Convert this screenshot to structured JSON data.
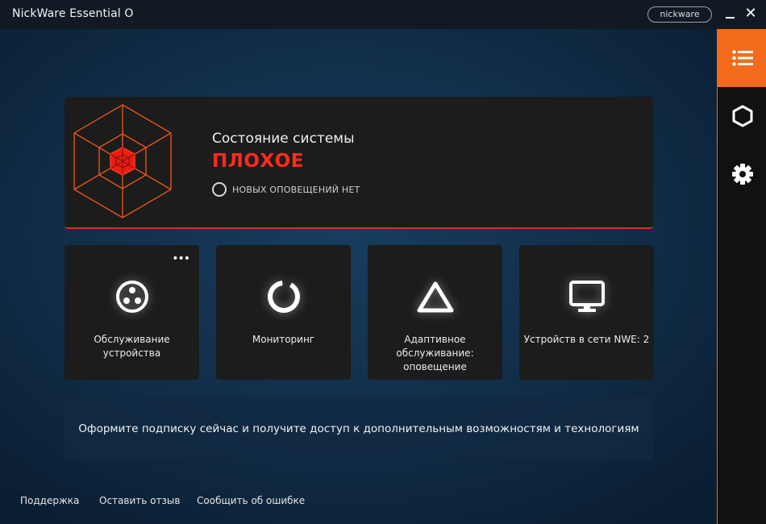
{
  "window": {
    "title": "NickWare Essential O",
    "user": "nickware",
    "minimize_icon": "minimize-icon",
    "close_icon": "close-icon"
  },
  "sidebar": {
    "items": [
      {
        "icon": "list-icon",
        "active": true
      },
      {
        "icon": "hexagon-icon",
        "active": false
      },
      {
        "icon": "gear-icon",
        "active": false
      }
    ]
  },
  "status": {
    "label": "Состояние системы",
    "value": "ПЛОХОЕ",
    "alerts": "НОВЫХ ОПОВЕЩЕНИЙ НЕТ",
    "icon": "hexagon-web-icon"
  },
  "tiles": [
    {
      "label": "Обслуживание устройства",
      "icon": "maintenance-icon",
      "has_menu": true,
      "menu_icon": "more-dots-icon"
    },
    {
      "label": "Мониторинг",
      "icon": "monitoring-ring-icon"
    },
    {
      "label": "Адаптивное обслуживание: оповещение",
      "icon": "triangle-icon"
    },
    {
      "label": "Устройств в сети NWE: 2",
      "icon": "monitor-icon"
    }
  ],
  "promo": {
    "text": "Оформите подписку сейчас и получите доступ к дополнительным возможностям и технологиям"
  },
  "footer": {
    "links": [
      "Поддержка",
      "Оставить отзыв",
      "Сообщить об ошибке"
    ]
  },
  "colors": {
    "accent": "#f36b1c",
    "danger": "#ff2b1c",
    "card": "#1c1c1c"
  }
}
